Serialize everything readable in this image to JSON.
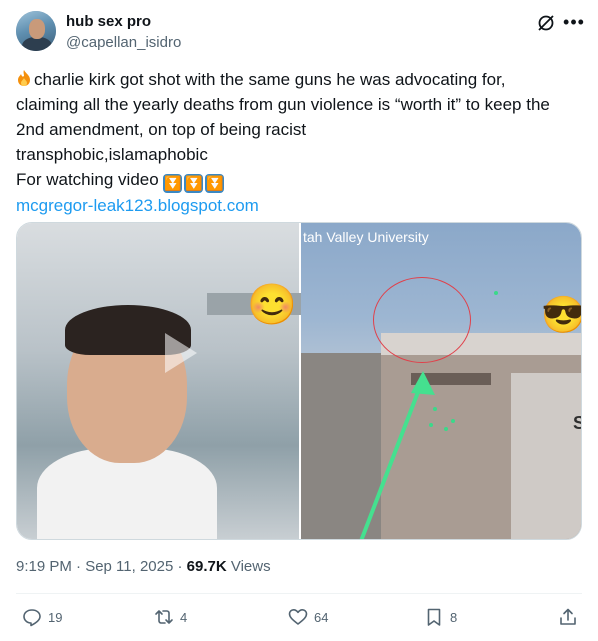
{
  "author": {
    "name": "hub sex pro",
    "handle": "@capellan_isidro"
  },
  "post": {
    "line1": "charlie kirk got shot with the same guns he was advocating for,",
    "line2": "claiming all the yearly deaths from gun violence is “worth it” to keep the",
    "line3": "2nd amendment, on top of being racist",
    "line4": "transphobic,islamaphobic",
    "line5": "For watching video",
    "link": "mcgregor-leak123.blogspot.com",
    "emoji_fire": "🔥",
    "arrow": "⏬"
  },
  "media": {
    "right_caption": "tah Valley University",
    "sign_letter": "S",
    "emoji_smile": "😊",
    "emoji_cool": "😎"
  },
  "meta": {
    "time": "9:19 PM · Sep 11, 2025 · ",
    "views_count": "69.7K",
    "views_label": " Views"
  },
  "actions": {
    "replies": "19",
    "reposts": "4",
    "likes": "64",
    "bookmarks": "8"
  },
  "colors": {
    "link": "#1d9bf0",
    "secondary": "#536471"
  }
}
